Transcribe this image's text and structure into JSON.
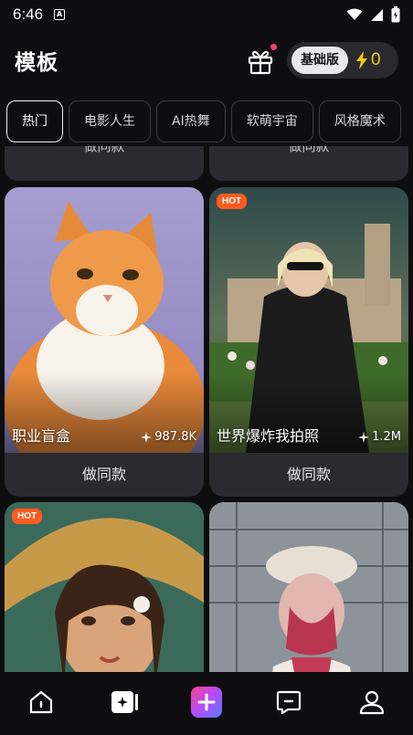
{
  "status": {
    "time": "6:46",
    "a_label": "A"
  },
  "header": {
    "title": "模板",
    "plan_label": "基础版",
    "credits": "0"
  },
  "tabs": [
    {
      "label": "热门",
      "active": true
    },
    {
      "label": "电影人生"
    },
    {
      "label": "AI热舞"
    },
    {
      "label": "软萌宇宙"
    },
    {
      "label": "风格魔术"
    }
  ],
  "feed": {
    "stub_button_label": "做同款",
    "cards": [
      {
        "title": "职业盲盒",
        "stat": "987.8K",
        "button_label": "做同款",
        "hot": false
      },
      {
        "title": "世界爆炸我拍照",
        "stat": "1.2M",
        "button_label": "做同款",
        "hot": true,
        "hot_label": "HOT"
      },
      {
        "hot": true,
        "hot_label": "HOT"
      },
      {
        "hot": false
      }
    ]
  },
  "bottom_nav": [
    {
      "icon": "home-icon"
    },
    {
      "icon": "template-icon"
    },
    {
      "icon": "create-plus-icon"
    },
    {
      "icon": "message-icon"
    },
    {
      "icon": "profile-icon"
    }
  ],
  "colors": {
    "accent_hot": "#ff5a1f",
    "credits": "#f5c518",
    "background": "#0e0e10",
    "card": "#2a2a30"
  }
}
